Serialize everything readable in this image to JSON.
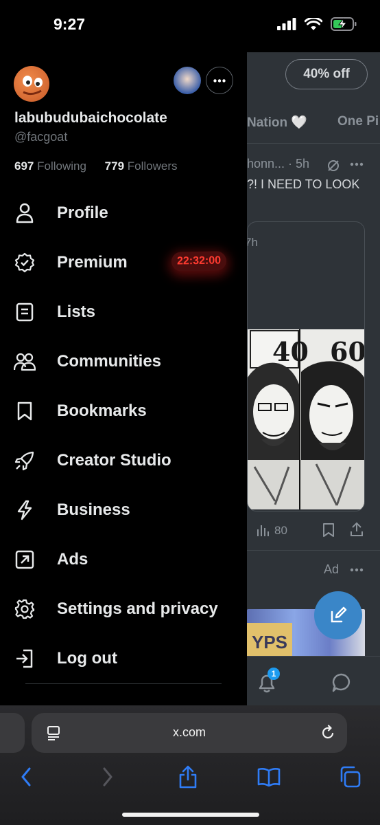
{
  "status_bar": {
    "time": "9:27"
  },
  "feed": {
    "offer_label": "40% off",
    "tabs": [
      "Nation 🤍",
      "One Pi"
    ],
    "post_meta": "honn... · 5h",
    "post_text": "?! I NEED TO LOOK",
    "quote_time": "7h",
    "manga_numbers": [
      "40",
      "60"
    ],
    "views": "80",
    "ad_label": "Ad",
    "ad_text": "YPS",
    "notification_count": "1"
  },
  "profile": {
    "display_name": "labubudubaichocolate",
    "handle": "@facgoat",
    "following_count": "697",
    "following_label": "Following",
    "followers_count": "779",
    "followers_label": "Followers"
  },
  "menu": {
    "items": [
      {
        "label": "Profile",
        "icon": "person-icon"
      },
      {
        "label": "Premium",
        "icon": "verified-badge-icon",
        "badge": "22:32:00"
      },
      {
        "label": "Lists",
        "icon": "list-icon"
      },
      {
        "label": "Communities",
        "icon": "communities-icon"
      },
      {
        "label": "Bookmarks",
        "icon": "bookmark-icon"
      },
      {
        "label": "Creator Studio",
        "icon": "rocket-icon"
      },
      {
        "label": "Business",
        "icon": "lightning-icon"
      },
      {
        "label": "Ads",
        "icon": "ads-arrow-icon"
      },
      {
        "label": "Settings and privacy",
        "icon": "gear-icon"
      },
      {
        "label": "Log out",
        "icon": "logout-icon"
      }
    ]
  },
  "safari": {
    "url": "x.com"
  },
  "colors": {
    "accent": "#1d9bf0",
    "timer": "#ff3b30",
    "safari_blue": "#2f7cf6"
  }
}
